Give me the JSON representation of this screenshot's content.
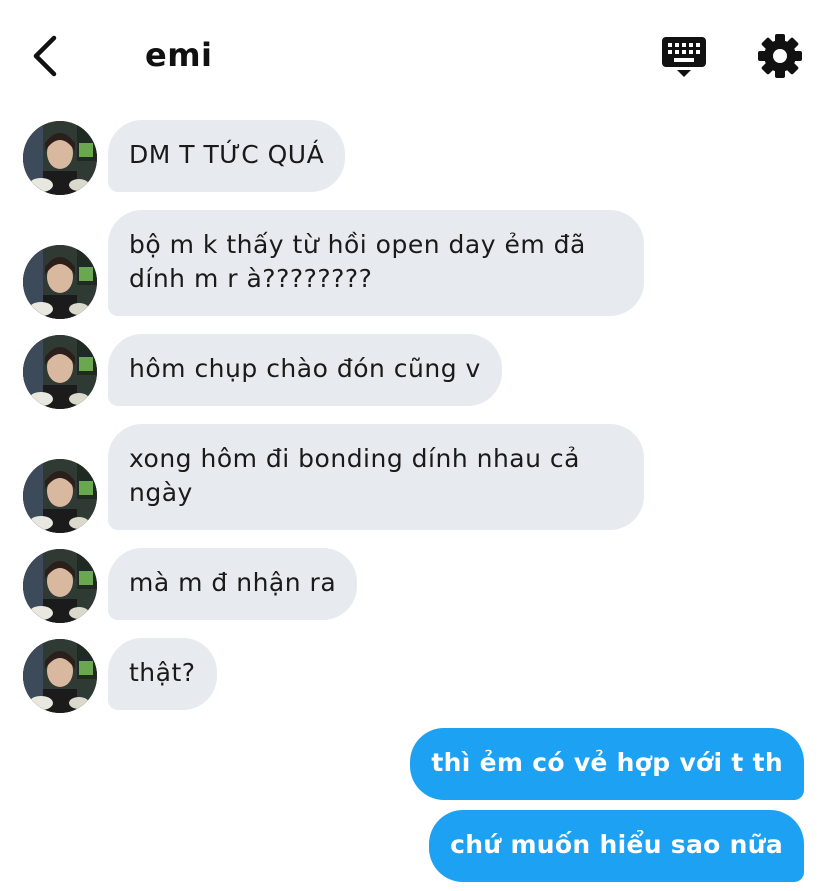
{
  "header": {
    "title": "emi",
    "back_icon": "chevron-left-icon",
    "keyboard_icon": "keyboard-icon",
    "settings_icon": "gear-icon"
  },
  "colors": {
    "incoming_bubble": "#e7ebef",
    "outgoing_bubble": "#1da1f2",
    "text": "#1a1a1a"
  },
  "messages": [
    {
      "from": "emi",
      "text": "DM T TỨC QUÁ"
    },
    {
      "from": "emi",
      "text": "bộ m k thấy từ hồi open day ẻm đã dính m r à????????"
    },
    {
      "from": "emi",
      "text": "hôm chụp chào đón cũng v"
    },
    {
      "from": "emi",
      "text": "xong hôm đi bonding dính nhau cả ngày"
    },
    {
      "from": "emi",
      "text": "mà m đ nhận ra"
    },
    {
      "from": "emi",
      "text": "thật?"
    },
    {
      "from": "me",
      "text": "thì ẻm có vẻ hợp với t th"
    },
    {
      "from": "me",
      "text": "chứ muốn hiểu sao nữa"
    }
  ]
}
